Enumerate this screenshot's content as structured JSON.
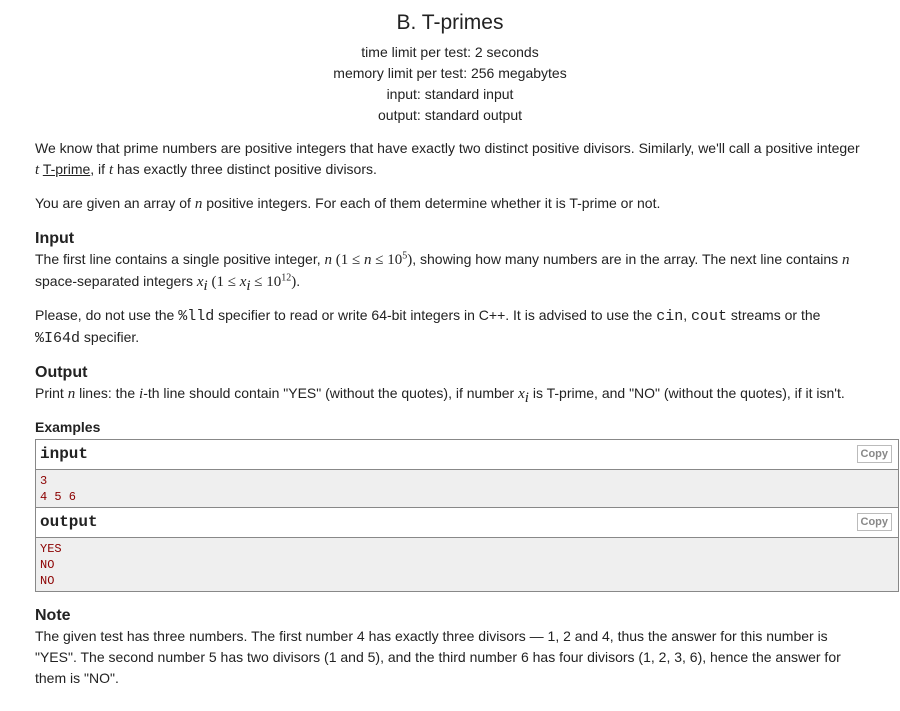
{
  "header": {
    "title": "B. T-primes",
    "time_limit": "time limit per test: 2 seconds",
    "memory_limit": "memory limit per test: 256 megabytes",
    "input": "input: standard input",
    "output": "output: standard output"
  },
  "statement": {
    "p1_a": "We know that prime numbers are positive integers that have exactly two distinct positive divisors. Similarly, we'll call a positive integer ",
    "p1_t": "t",
    "p1_link": "T-prime",
    "p1_b": ", if ",
    "p1_t2": "t",
    "p1_c": " has exactly three distinct positive divisors.",
    "p2_a": "You are given an array of ",
    "p2_n": "n",
    "p2_b": " positive integers. For each of them determine whether it is T-prime or not."
  },
  "input_section": {
    "title": "Input",
    "p1_a": "The first line contains a single positive integer, ",
    "p1_n": "n",
    "p1_range_open": " (1 ≤ ",
    "p1_range_n": "n",
    "p1_range_le": " ≤ 10",
    "p1_range_exp": "5",
    "p1_range_close": ")",
    "p1_b": ", showing how many numbers are in the array. The next line contains ",
    "p1_n2": "n",
    "p1_c": " space-separated integers ",
    "p1_x": "x",
    "p1_i": "i",
    "p1_range2_open": " (1 ≤ ",
    "p1_range2_x": "x",
    "p1_range2_i": "i",
    "p1_range2_le": " ≤ 10",
    "p1_range2_exp": "12",
    "p1_range2_close": ")",
    "p1_d": ".",
    "p2_a": "Please, do not use the ",
    "p2_lld": "%lld",
    "p2_b": " specifier to read or write 64-bit integers in C++. It is advised to use the ",
    "p2_cin": "cin",
    "p2_comma": ", ",
    "p2_cout": "cout",
    "p2_c": " streams or the ",
    "p2_i64d": "%I64d",
    "p2_d": " specifier."
  },
  "output_section": {
    "title": "Output",
    "p_a": "Print ",
    "p_n": "n",
    "p_b": " lines: the ",
    "p_i": "i",
    "p_c": "-th line should contain \"YES\" (without the quotes), if number ",
    "p_x": "x",
    "p_xi": "i",
    "p_d": " is T-prime, and \"NO\" (without the quotes), if it isn't."
  },
  "examples": {
    "title": "Examples",
    "input_label": "input",
    "output_label": "output",
    "copy_label": "Copy",
    "input_text": "3\n4 5 6",
    "output_text": "YES\nNO\nNO"
  },
  "note": {
    "title": "Note",
    "text": "The given test has three numbers. The first number 4 has exactly three divisors — 1, 2 and 4, thus the answer for this number is \"YES\". The second number 5 has two divisors (1 and 5), and the third number 6 has four divisors (1, 2, 3, 6), hence the answer for them is \"NO\"."
  }
}
